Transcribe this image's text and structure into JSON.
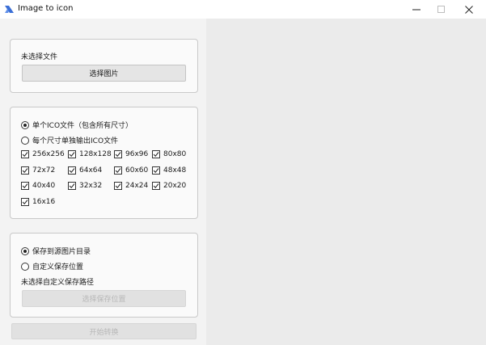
{
  "window": {
    "title": "Image to icon",
    "minimize": "minimize",
    "maximize": "maximize",
    "close": "close"
  },
  "file": {
    "status": "未选择文件",
    "select_button": "选择图片"
  },
  "mode": {
    "options": [
      {
        "label": "单个ICO文件（包含所有尺寸）",
        "selected": true
      },
      {
        "label": "每个尺寸单独输出ICO文件",
        "selected": false
      }
    ],
    "sizes": [
      {
        "label": "256x256",
        "checked": true
      },
      {
        "label": "128x128",
        "checked": true
      },
      {
        "label": "96x96",
        "checked": true
      },
      {
        "label": "80x80",
        "checked": true
      },
      {
        "label": "72x72",
        "checked": true
      },
      {
        "label": "64x64",
        "checked": true
      },
      {
        "label": "60x60",
        "checked": true
      },
      {
        "label": "48x48",
        "checked": true
      },
      {
        "label": "40x40",
        "checked": true
      },
      {
        "label": "32x32",
        "checked": true
      },
      {
        "label": "24x24",
        "checked": true
      },
      {
        "label": "20x20",
        "checked": true
      },
      {
        "label": "16x16",
        "checked": true
      }
    ]
  },
  "save": {
    "options": [
      {
        "label": "保存到源图片目录",
        "selected": true
      },
      {
        "label": "自定义保存位置",
        "selected": false
      }
    ],
    "path_status": "未选择自定义保存路径",
    "select_location_button": "选择保存位置"
  },
  "start_button": "开始转换"
}
